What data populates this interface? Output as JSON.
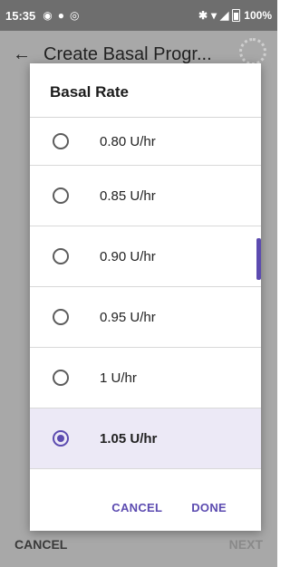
{
  "status_bar": {
    "time": "15:35",
    "battery": "100%",
    "icons": [
      "target-icon",
      "dot-icon",
      "at-icon",
      "bluetooth-icon",
      "wifi-icon",
      "signal-icon",
      "battery-icon"
    ]
  },
  "app_bar": {
    "title": "Create Basal Progr...",
    "back_icon": "arrow-left-icon",
    "status_icon": "pod-ring-icon"
  },
  "dialog": {
    "title": "Basal Rate",
    "options": [
      {
        "label": "0.80 U/hr",
        "selected": false
      },
      {
        "label": "0.85 U/hr",
        "selected": false
      },
      {
        "label": "0.90 U/hr",
        "selected": false
      },
      {
        "label": "0.95 U/hr",
        "selected": false
      },
      {
        "label": "1 U/hr",
        "selected": false
      },
      {
        "label": "1.05 U/hr",
        "selected": true
      }
    ],
    "cancel_label": "CANCEL",
    "done_label": "DONE"
  },
  "bottom_bar": {
    "cancel_label": "CANCEL",
    "next_label": "NEXT"
  },
  "colors": {
    "accent": "#5c4bb0",
    "selected_row": "#ece9f6",
    "overlay": "#a8a8a8"
  }
}
